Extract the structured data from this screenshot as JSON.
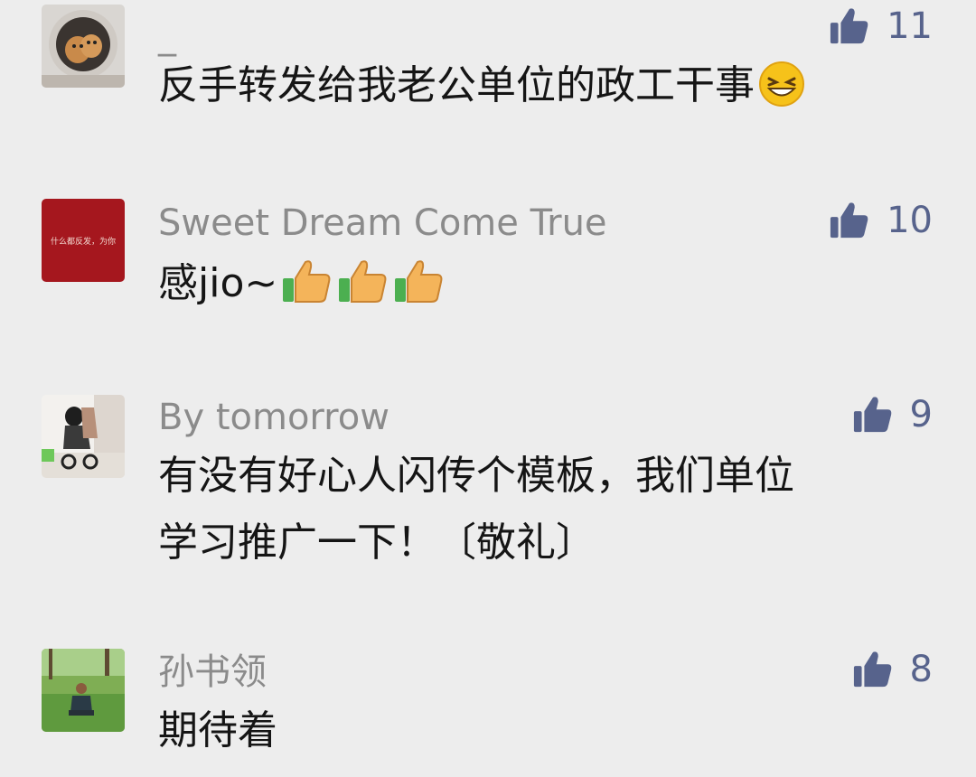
{
  "colors": {
    "name": "#8b8b8b",
    "text": "#151515",
    "like": "#57638c",
    "background": "#ededed"
  },
  "comments": [
    {
      "name": "_",
      "text": "反手转发给我老公单位的政工干事",
      "likes": "11",
      "avatar_icon": "cat-in-washing-machine-photo",
      "emoji": "grinning-squint-emoji"
    },
    {
      "name": "Sweet Dream Come True",
      "text": "感jio~",
      "likes": "10",
      "avatar_icon": "red-calligraphy-avatar",
      "avatar_text": "什么都反发，为你",
      "emoji": "thumbs-up-emoji"
    },
    {
      "name": "By tomorrow",
      "lines": [
        "有没有好心人闪传个模板，我们单位",
        "学习推广一下！〔敬礼〕"
      ],
      "likes": "9",
      "avatar_icon": "stroller-photo"
    },
    {
      "name": "孙书领",
      "text": "期待着",
      "likes": "8",
      "avatar_icon": "person-on-grass-photo"
    }
  ]
}
